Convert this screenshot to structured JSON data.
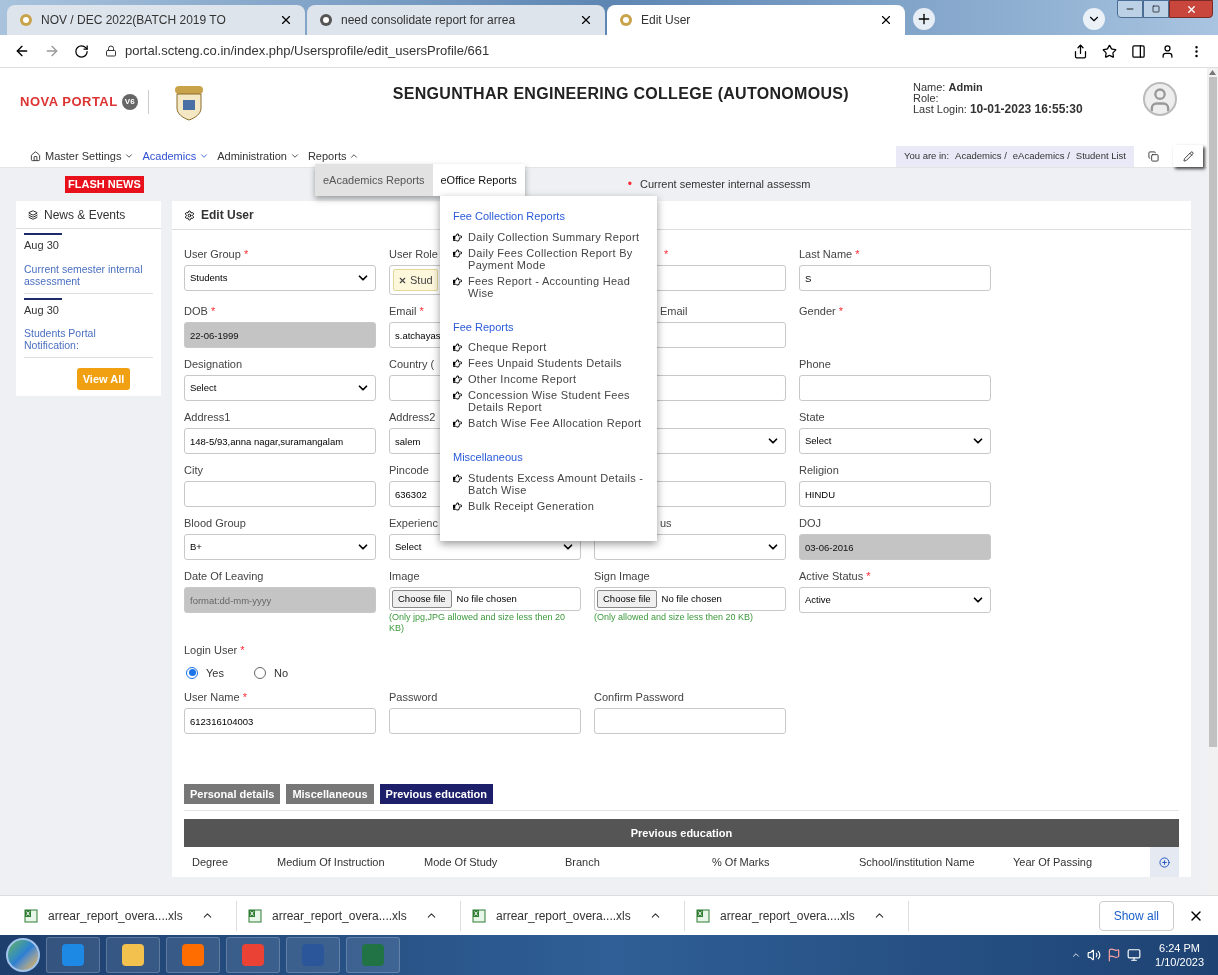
{
  "browser": {
    "tabs": [
      {
        "title": "NOV / DEC 2022(BATCH 2019 TO",
        "selected": false
      },
      {
        "title": "need consolidate report for arrea",
        "selected": false
      },
      {
        "title": "Edit User",
        "selected": true
      }
    ],
    "url": "portal.scteng.co.in/index.php/Usersprofile/edit_usersProfile/661"
  },
  "header": {
    "logo": "NOVA PORTAL",
    "version": "V6",
    "college": "SENGUNTHAR ENGINEERING COLLEGE (AUTONOMOUS)",
    "name_label": "Name:",
    "name": "Admin",
    "role_label": "Role:",
    "login_label": "Last Login:",
    "last_login": "10-01-2023 16:55:30"
  },
  "nav": {
    "items": [
      {
        "label": "Master Settings",
        "selected": false,
        "expanded": false
      },
      {
        "label": "Academics",
        "selected": true,
        "expanded": false
      },
      {
        "label": "Administration",
        "selected": false,
        "expanded": false
      },
      {
        "label": "Reports",
        "selected": false,
        "expanded": true
      }
    ],
    "breadcrumb_label": "You are in:",
    "breadcrumb": [
      "Academics /",
      "eAcademics /",
      "Student List"
    ]
  },
  "flash_news": {
    "label": "FLASH NEWS",
    "bullet": "•",
    "ticker": "Current semester internal assessm"
  },
  "reports_menu": {
    "items": [
      {
        "label": "eAcademics Reports",
        "selected": false
      },
      {
        "label": "eOffice Reports",
        "selected": true
      }
    ],
    "sections": [
      {
        "title": "Fee Collection Reports",
        "items": [
          "Daily Collection Summary Report",
          "Daily Fees Collection Report By Payment Mode",
          "Fees Report - Accounting Head Wise"
        ]
      },
      {
        "title": "Fee Reports",
        "items": [
          "Cheque Report",
          "Fees Unpaid Students Details",
          "Other Income Report",
          "Concession Wise Student Fees Details Report",
          "Batch Wise Fee Allocation Report"
        ]
      },
      {
        "title": "Miscellaneous",
        "items": [
          "Students Excess Amount Details - Batch Wise",
          "Bulk Receipt Generation"
        ]
      }
    ]
  },
  "news": {
    "title": "News & Events",
    "items": [
      {
        "date": "Aug 30",
        "title": "Current semester internal assessment"
      },
      {
        "date": "Aug 30",
        "title": "Students Portal Notification:"
      }
    ],
    "button": "View All"
  },
  "form": {
    "title": "Edit User",
    "rows": [
      [
        {
          "kind": "select",
          "label": "User Group",
          "mark": "*",
          "value": "Students"
        },
        {
          "kind": "tag",
          "label": "User Role",
          "value": "Stud"
        },
        {
          "kind": "text",
          "mark": "*"
        },
        {
          "kind": "text",
          "label": "Last Name",
          "mark": "*",
          "value": "S"
        }
      ],
      [
        {
          "kind": "text",
          "label": "DOB",
          "mark": "*",
          "value": "22-06-1999",
          "disabled": true
        },
        {
          "kind": "text",
          "label": "Email",
          "mark": "*",
          "value": "s.atchayas",
          "disabled": false
        },
        {
          "kind": "text",
          "label": "Email"
        },
        {
          "kind": "none",
          "label": "Gender",
          "mark": "*"
        }
      ],
      [
        {
          "kind": "select",
          "label": "Designation",
          "value": "Select"
        },
        {
          "kind": "text",
          "label": "Country ("
        },
        {
          "kind": "text"
        },
        {
          "kind": "text",
          "label": "Phone"
        }
      ],
      [
        {
          "kind": "text",
          "label": "Address1",
          "value": "148-5/93,anna nagar,suramangalam",
          "disabled": false
        },
        {
          "kind": "text",
          "label": "Address2",
          "value": "salem",
          "disabled": false
        },
        {
          "kind": "select"
        },
        {
          "kind": "select",
          "label": "State",
          "value": "Select"
        }
      ],
      [
        {
          "kind": "text",
          "label": "City"
        },
        {
          "kind": "text",
          "label": "Pincode",
          "value": "636302",
          "disabled": false
        },
        {
          "kind": "text"
        },
        {
          "kind": "text",
          "label": "Religion",
          "value": "HINDU",
          "disabled": false
        }
      ],
      [
        {
          "kind": "select",
          "label": "Blood Group",
          "value": "B+"
        },
        {
          "kind": "select",
          "label": "Experienc",
          "value": "Select"
        },
        {
          "kind": "select",
          "label": "us"
        },
        {
          "kind": "text",
          "label": "DOJ",
          "value": "03-06-2016",
          "disabled": true
        }
      ],
      [
        {
          "kind": "text",
          "label": "Date Of Leaving",
          "placeholder": "format:dd-mm-yyyy",
          "disabled": true
        },
        {
          "kind": "file",
          "label": "Image",
          "button": "Choose file",
          "status": "No file chosen",
          "note": "(Only jpg,JPG allowed and size less then 20 KB)"
        },
        {
          "kind": "file",
          "label": "Sign Image",
          "button": "Choose file",
          "status": "No file chosen",
          "note": "(Only allowed and size less then 20 KB)"
        },
        {
          "kind": "select",
          "label": "Active Status",
          "mark": "*",
          "value": "Active"
        }
      ]
    ],
    "login_user": {
      "label": "Login User",
      "mark": "*",
      "options": [
        {
          "label": "Yes",
          "selected": true
        },
        {
          "label": "No",
          "selected": false
        }
      ]
    },
    "account_row": [
      {
        "kind": "text",
        "label": "User Name",
        "mark": "*",
        "value": "612316104003",
        "disabled": false
      },
      {
        "kind": "text",
        "label": "Password"
      },
      {
        "kind": "text",
        "label": "Confirm Password"
      }
    ]
  },
  "section_tabs": [
    {
      "label": "Personal details",
      "selected": false
    },
    {
      "label": "Miscellaneous",
      "selected": false
    },
    {
      "label": "Previous education",
      "selected": true
    }
  ],
  "table": {
    "title": "Previous education",
    "columns": [
      "Degree",
      "Medium Of Instruction",
      "Mode Of Study",
      "Branch",
      "% Of Marks",
      "School/institution Name",
      "Year Of Passing"
    ]
  },
  "downloads": {
    "items": [
      "arrear_report_overa....xls",
      "arrear_report_overa....xls",
      "arrear_report_overa....xls",
      "arrear_report_overa....xls"
    ],
    "show_all": "Show all"
  },
  "taskbar": {
    "time": "6:24 PM",
    "date": "1/10/2023"
  }
}
